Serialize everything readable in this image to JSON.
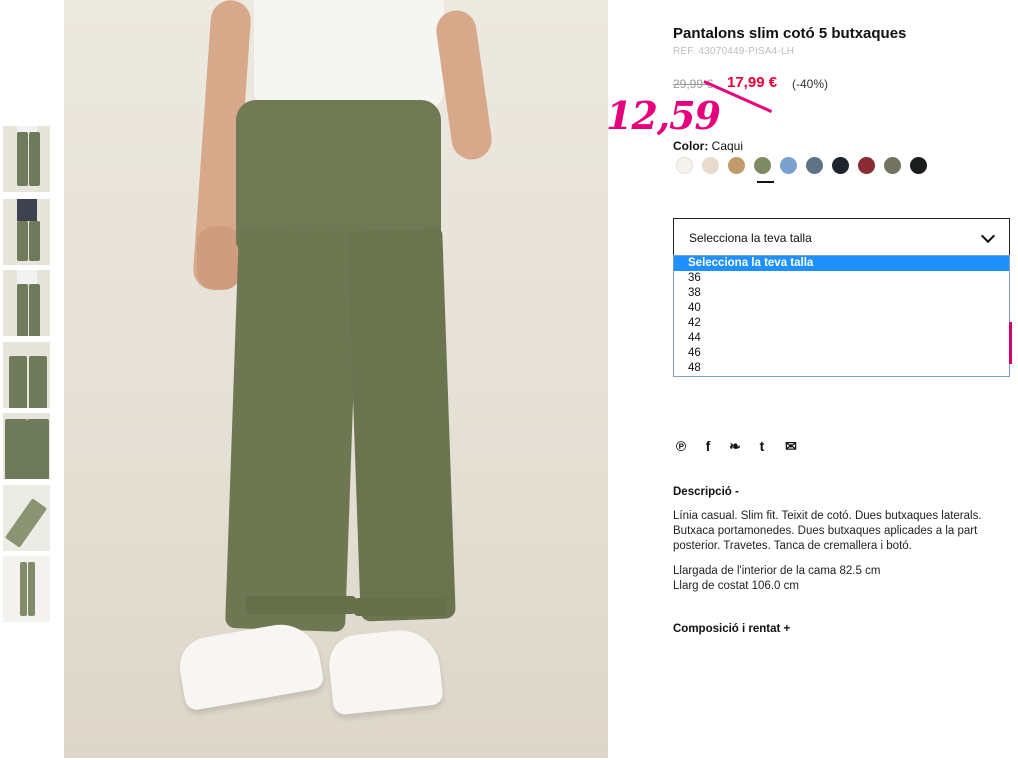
{
  "product": {
    "title": "Pantalons slim cotó 5 butxaques",
    "ref": "REF. 43070449-PISA4-LH",
    "price_old": "29,99 €",
    "price_new": "17,99 €",
    "discount": "(-40%)",
    "handwritten_price": "12,59"
  },
  "color": {
    "label": "Color:",
    "value": "Caqui",
    "swatches": [
      "#f6f3ee",
      "#e6dbcd",
      "#c29a6c",
      "#7d8a63",
      "#7aa1cf",
      "#5f7386",
      "#1c2430",
      "#8a2b33",
      "#727361",
      "#1b1c1c"
    ],
    "selected_index": 3
  },
  "size": {
    "placeholder": "Selecciona la teva talla",
    "options": [
      "Selecciona la teva talla",
      "36",
      "38",
      "40",
      "42",
      "44",
      "46",
      "48"
    ],
    "highlighted_index": 0
  },
  "share_icons": [
    "pinterest-icon",
    "facebook-icon",
    "twitter-icon",
    "tumblr-icon",
    "mail-icon"
  ],
  "share_glyphs": [
    "℗",
    "f",
    "❧",
    "t",
    "✉"
  ],
  "description": {
    "heading": "Descripció  -",
    "text": "Línia casual. Slim fit. Teixit de cotó. Dues butxaques laterals. Butxaca portamonedes. Dues butxaques aplicades a la part posterior. Travetes. Tanca de cremallera i botó.",
    "measure1": "Llargada de l'interior de la cama 82.5 cm",
    "measure2": "Llarg de costat 106.0 cm"
  },
  "composition": {
    "heading": "Composició i rentat  +"
  }
}
